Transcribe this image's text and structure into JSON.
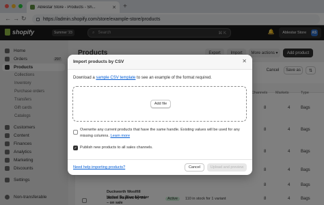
{
  "browser": {
    "tab_title": "Ablestar Store - Products - Sh...",
    "url": "https://admin.shopify.com/store/example-store/products",
    "dot_colors": [
      "#ff5f57",
      "#febc2e",
      "#28c840"
    ]
  },
  "topbar": {
    "logo": "shopify",
    "plan_badge": "Summer '23",
    "search_placeholder": "Search",
    "search_shortcut": "⌘ K",
    "store_name": "Ablestar Store",
    "store_initials": "AS"
  },
  "sidebar": {
    "items": [
      {
        "label": "Home"
      },
      {
        "label": "Orders",
        "count": "297"
      },
      {
        "label": "Products"
      },
      {
        "label": "Customers"
      },
      {
        "label": "Content"
      },
      {
        "label": "Finances"
      },
      {
        "label": "Analytics"
      },
      {
        "label": "Marketing"
      },
      {
        "label": "Discounts"
      },
      {
        "label": "Settings"
      },
      {
        "label": "Non-transferable"
      }
    ],
    "subitems": [
      "Collections",
      "Inventory",
      "Purchase orders",
      "Transfers",
      "Gift cards",
      "Catalogs"
    ]
  },
  "page": {
    "title": "Products",
    "export": "Export",
    "import": "Import",
    "more_actions": "More actions",
    "add_product": "Add product",
    "cancel": "Cancel",
    "save_as": "Save as",
    "columns": [
      "Channels",
      "Markets",
      "Type"
    ],
    "rows": [
      {
        "channels": "8",
        "markets": "4",
        "type": "Bags"
      },
      {
        "channels": "8",
        "markets": "4",
        "type": "Bags"
      },
      {
        "channels": "8",
        "markets": "4",
        "type": "Bags"
      },
      {
        "channels": "8",
        "markets": "4",
        "type": "Bags"
      },
      {
        "channels": "8",
        "markets": "4",
        "type": "Bags"
      },
      {
        "channels": "8",
        "markets": "4",
        "type": "Bags"
      }
    ],
    "last_row": {
      "name_line1": "United By Blue Allwater",
      "name_line2": "– on sale",
      "status": "Active",
      "inventory": "110 in stock for 1 variant",
      "channels": "8",
      "markets": "4",
      "type": "Bags"
    },
    "cut_row": {
      "line1": "Duckworth Woolfill",
      "line2": "Jacket inspired by the"
    }
  },
  "modal": {
    "title": "Import products by CSV",
    "desc_pre": "Download a ",
    "desc_link": "sample CSV template",
    "desc_post": " to see an example of the format required.",
    "add_file": "Add file",
    "overwrite_label": "Overwrite any current products that have the same handle. Existing values will be used for any missing columns.",
    "overwrite_link": "Learn more",
    "publish_label": "Publish new products to all sales channels.",
    "help_link": "Need help importing products?",
    "cancel": "Cancel",
    "upload": "Upload and preview"
  }
}
